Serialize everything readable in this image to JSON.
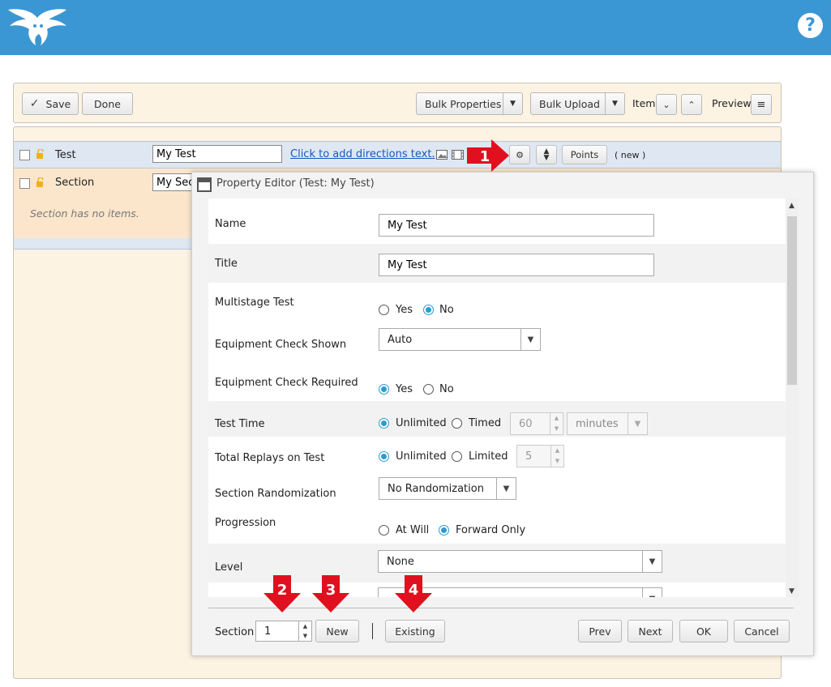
{
  "header": {
    "help_label": "?"
  },
  "toolbar": {
    "save_label": "Save",
    "done_label": "Done",
    "bulk_properties_label": "Bulk Properties",
    "bulk_upload_label": "Bulk Upload",
    "item_label": "Item",
    "preview_label": "Preview"
  },
  "tree": {
    "test_row": {
      "label": "Test",
      "name_value": "My Test",
      "directions_link": "Click to add directions text.",
      "points_label": "Points",
      "status": "( new )"
    },
    "section_row": {
      "label": "Section",
      "name_value": "My Sec",
      "empty_text": "Section has no items."
    }
  },
  "annotations": {
    "one": "1",
    "two": "2",
    "three": "3",
    "four": "4"
  },
  "dialog": {
    "title": "Property Editor (Test: My Test)",
    "fields": {
      "name": {
        "label": "Name",
        "value": "My Test"
      },
      "title": {
        "label": "Title",
        "value": "My Test"
      },
      "multistage": {
        "label": "Multistage Test",
        "yes": "Yes",
        "no": "No",
        "selected": "No"
      },
      "equip_shown": {
        "label": "Equipment Check Shown",
        "value": "Auto"
      },
      "equip_required": {
        "label": "Equipment Check Required",
        "yes": "Yes",
        "no": "No",
        "selected": "Yes"
      },
      "test_time": {
        "label": "Test Time",
        "unlimited": "Unlimited",
        "timed": "Timed",
        "amount": "60",
        "unit": "minutes",
        "selected": "Unlimited"
      },
      "replays": {
        "label": "Total Replays on Test",
        "unlimited": "Unlimited",
        "limited": "Limited",
        "amount": "5",
        "selected": "Unlimited"
      },
      "randomization": {
        "label": "Section Randomization",
        "value": "No Randomization"
      },
      "progression": {
        "label": "Progression",
        "at_will": "At Will",
        "forward_only": "Forward Only",
        "selected": "Forward Only"
      },
      "level": {
        "label": "Level",
        "value": "None"
      }
    },
    "footer": {
      "section_label": "Section",
      "section_value": "1",
      "new_label": "New",
      "existing_label": "Existing",
      "prev_label": "Prev",
      "next_label": "Next",
      "ok_label": "OK",
      "cancel_label": "Cancel"
    }
  },
  "colors": {
    "header": "#3b97d3",
    "panel": "#fdf3e3",
    "test_row": "#dfe7f2",
    "section_row": "#fbe6cc",
    "accent": "#2b9bd0",
    "marker": "#e0101e"
  }
}
